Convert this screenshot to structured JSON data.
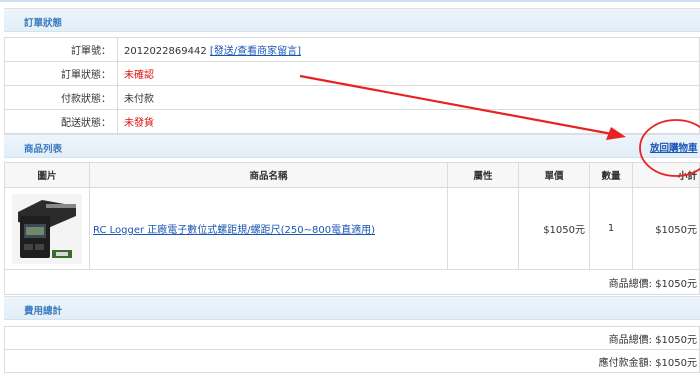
{
  "order_status": {
    "section_title": "訂單狀態",
    "order_no_label": "訂單號：",
    "order_no_value": "2012022869442",
    "message_link": "[發送/查看商家留言]",
    "order_state_label": "訂單狀態：",
    "order_state_value": "未確認",
    "payment_state_label": "付款狀態：",
    "payment_state_value": "未付款",
    "shipping_state_label": "配送狀態：",
    "shipping_state_value": "未發貨"
  },
  "product_list": {
    "section_title": "商品列表",
    "back_to_cart": "放回購物車",
    "headers": [
      "圖片",
      "商品名稱",
      "屬性",
      "單價",
      "數量",
      "小計"
    ],
    "rows": [
      {
        "image": "rc-logger-gauge-photo",
        "name": "RC Logger 正廠電子數位式螺距規/螺距尺(250~800電直適用)",
        "attribute": "",
        "unit_price": "$1050元",
        "quantity": "1",
        "subtotal": "$1050元"
      }
    ],
    "total_text": "商品總價: $1050元"
  },
  "fee_summary": {
    "section_title": "費用總計",
    "goods_total": "商品總價: $1050元",
    "amount_due": "應付款金額: $1050元"
  },
  "colors": {
    "accent_blue": "#3a7bbf",
    "link_blue": "#1a56b6",
    "alert_red": "#e01010",
    "annotation_red": "#e82222"
  }
}
